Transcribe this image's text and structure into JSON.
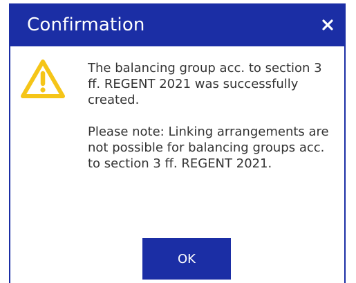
{
  "dialog": {
    "title": "Confirmation",
    "close_icon": "close-icon",
    "warning_icon": "warning-triangle-icon",
    "message_paragraphs": [
      "The balancing group acc. to section 3 ff. REGENT 2021 was successfully created.",
      "Please note: Linking arrangements are not possible for balancing groups acc. to section 3 ff. REGENT 2021."
    ],
    "ok_label": "OK"
  },
  "colors": {
    "accent": "#1b2ea5",
    "warning": "#f5c518",
    "text": "#333333"
  }
}
